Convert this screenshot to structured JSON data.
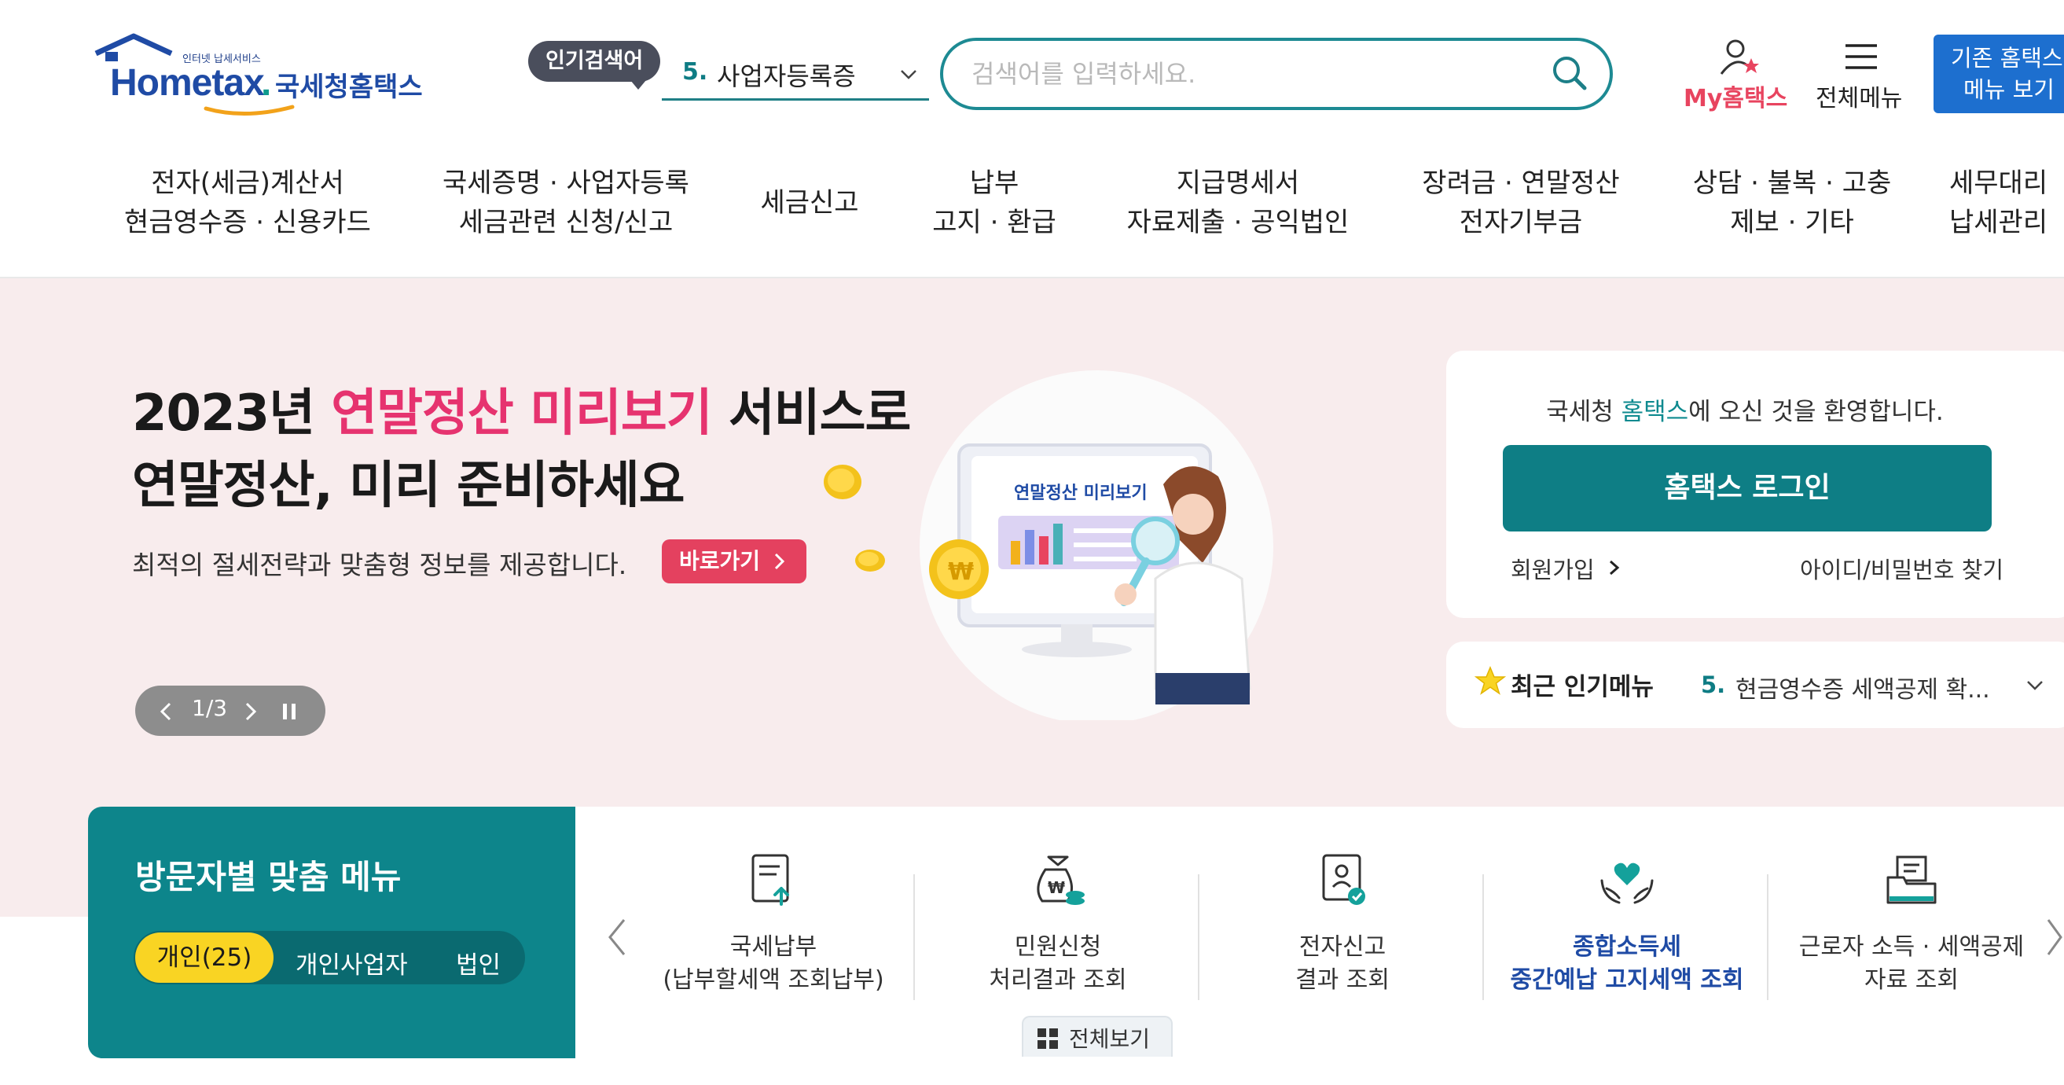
{
  "header": {
    "logo_tagline": "인터넷 납세서비스",
    "logo_wordmark": "Hometax",
    "logo_brand": "국세청홈택스",
    "popular_badge": "인기검색어",
    "popular_rank": "5.",
    "popular_term": "사업자등록증",
    "search_placeholder": "검색어를 입력하세요.",
    "my_hometax": "My홈택스",
    "all_menu": "전체메뉴",
    "legacy_line1": "기존 홈택스",
    "legacy_line2": "메뉴 보기"
  },
  "gnb": [
    {
      "line1": "전자(세금)계산서",
      "line2": "현금영수증 · 신용카드"
    },
    {
      "line1": "국세증명 · 사업자등록",
      "line2": "세금관련 신청/신고"
    },
    {
      "line1": "세금신고",
      "line2": ""
    },
    {
      "line1": "납부",
      "line2": "고지 · 환급"
    },
    {
      "line1": "지급명세서",
      "line2": "자료제출 · 공익법인"
    },
    {
      "line1": "장려금 · 연말정산",
      "line2": "전자기부금"
    },
    {
      "line1": "상담 · 불복 · 고충",
      "line2": "제보 · 기타"
    },
    {
      "line1": "세무대리",
      "line2": "납세관리"
    }
  ],
  "hero": {
    "title_pre": "2023년 ",
    "title_highlight": "연말정산 미리보기",
    "title_post": " 서비스로",
    "title_line2": "연말정산, 미리 준비하세요",
    "subtitle": "최적의 절세전략과 맞춤형 정보를 제공합니다.",
    "cta": "바로가기",
    "illustration_label": "연말정산 미리보기",
    "slide_counter": "1/3",
    "accent_color": "#e6336f"
  },
  "login": {
    "welcome_pre": "국세청 ",
    "welcome_brand": "홈택스",
    "welcome_post": "에 오신 것을 환영합니다.",
    "login_button": "홈택스 로그인",
    "signup": "회원가입",
    "find_account": "아이디/비밀번호 찾기"
  },
  "recent": {
    "label": "최근 인기메뉴",
    "rank": "5.",
    "item": "현금영수증 세액공제 확..."
  },
  "visitor": {
    "title": "방문자별 맞춤 메뉴",
    "tabs": [
      "개인(25)",
      "개인사업자",
      "법인"
    ],
    "view_all": "전체보기",
    "items": [
      {
        "line1": "국세납부",
        "line2": "(납부할세액 조회납부)",
        "icon": "tax-payment-icon"
      },
      {
        "line1": "민원신청",
        "line2": "처리결과 조회",
        "icon": "money-bag-icon"
      },
      {
        "line1": "전자신고",
        "line2": "결과 조회",
        "icon": "e-filing-icon"
      },
      {
        "line1": "종합소득세",
        "line2": "중간예납 고지세액 조회",
        "icon": "heart-hands-icon"
      },
      {
        "line1": "근로자 소득 · 세액공제",
        "line2": "자료 조회",
        "icon": "folder-icon"
      }
    ]
  },
  "colors": {
    "teal": "#0d858b",
    "pink": "#e6336f",
    "blue": "#1f4ba5",
    "hero_bg": "#f8eced",
    "yellow": "#f9d423"
  }
}
